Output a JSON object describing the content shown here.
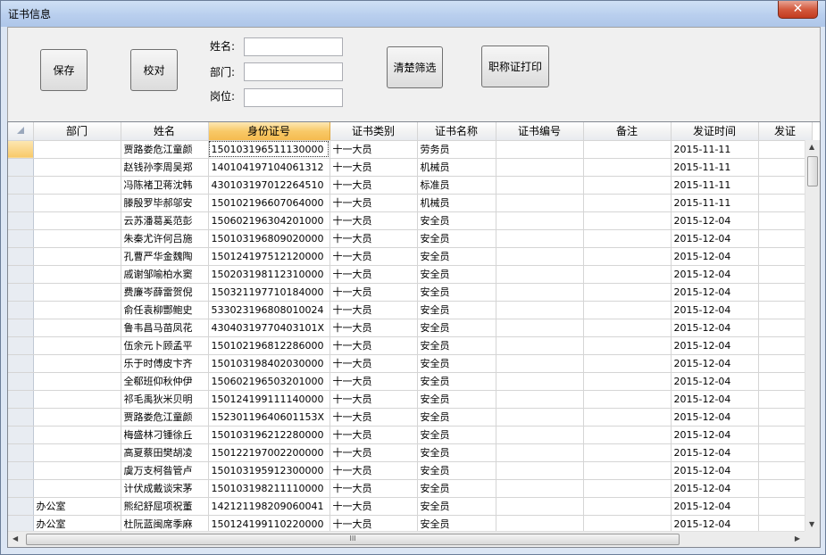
{
  "window": {
    "title": "证书信息",
    "close_glyph": "✕"
  },
  "toolbar": {
    "save_label": "保存",
    "check_label": "校对",
    "clear_filter_label": "清楚筛选",
    "print_label": "职称证打印",
    "name_label": "姓名:",
    "dept_label": "部门:",
    "post_label": "岗位:",
    "name_value": "",
    "dept_value": "",
    "post_value": ""
  },
  "grid": {
    "columns": [
      "部门",
      "姓名",
      "身份证号",
      "证书类别",
      "证书名称",
      "证书编号",
      "备注",
      "发证时间",
      "发证"
    ],
    "rows": [
      [
        "",
        "贾路娄危江童颜",
        "150103196511130000",
        "十一大员",
        "劳务员",
        "",
        "",
        "2015-11-11"
      ],
      [
        "",
        "赵钱孙李周吴郑",
        "140104197104061312",
        "十一大员",
        "机械员",
        "",
        "",
        "2015-11-11"
      ],
      [
        "",
        "冯陈褚卫蒋沈韩",
        "430103197012264510",
        "十一大员",
        "标准员",
        "",
        "",
        "2015-11-11"
      ],
      [
        "",
        "滕殷罗毕郝邬安",
        "150102196607064000",
        "十一大员",
        "机械员",
        "",
        "",
        "2015-11-11"
      ],
      [
        "",
        "云苏潘葛奚范彭",
        "150602196304201000",
        "十一大员",
        "安全员",
        "",
        "",
        "2015-12-04"
      ],
      [
        "",
        "朱秦尤许何吕施",
        "150103196809020000",
        "十一大员",
        "安全员",
        "",
        "",
        "2015-12-04"
      ],
      [
        "",
        "孔曹严华金魏陶",
        "150124197512120000",
        "十一大员",
        "安全员",
        "",
        "",
        "2015-12-04"
      ],
      [
        "",
        "戚谢邹喻柏水窦",
        "150203198112310000",
        "十一大员",
        "安全员",
        "",
        "",
        "2015-12-04"
      ],
      [
        "",
        "费廉岑薛雷贺倪",
        "150321197710184000",
        "十一大员",
        "安全员",
        "",
        "",
        "2015-12-04"
      ],
      [
        "",
        "俞任袁柳酆鲍史",
        "533023196808010024",
        "十一大员",
        "安全员",
        "",
        "",
        "2015-12-04"
      ],
      [
        "",
        "鲁韦昌马苗凤花",
        "43040319770403101X",
        "十一大员",
        "安全员",
        "",
        "",
        "2015-12-04"
      ],
      [
        "",
        "伍余元卜顾孟平",
        "150102196812286000",
        "十一大员",
        "安全员",
        "",
        "",
        "2015-12-04"
      ],
      [
        "",
        "乐于时傅皮卞齐",
        "150103198402030000",
        "十一大员",
        "安全员",
        "",
        "",
        "2015-12-04"
      ],
      [
        "",
        "全郗班仰秋仲伊",
        "150602196503201000",
        "十一大员",
        "安全员",
        "",
        "",
        "2015-12-04"
      ],
      [
        "",
        "祁毛禹狄米贝明",
        "150124199111140000",
        "十一大员",
        "安全员",
        "",
        "",
        "2015-12-04"
      ],
      [
        "",
        "贾路娄危江童颜",
        "15230119640601153X",
        "十一大员",
        "安全员",
        "",
        "",
        "2015-12-04"
      ],
      [
        "",
        "梅盛林刁锺徐丘",
        "150103196212280000",
        "十一大员",
        "安全员",
        "",
        "",
        "2015-12-04"
      ],
      [
        "",
        "高夏蔡田樊胡凌",
        "150122197002200000",
        "十一大员",
        "安全员",
        "",
        "",
        "2015-12-04"
      ],
      [
        "",
        "虞万支柯昝管卢",
        "150103195912300000",
        "十一大员",
        "安全员",
        "",
        "",
        "2015-12-04"
      ],
      [
        "",
        "计伏成戴谈宋茅",
        "150103198211110000",
        "十一大员",
        "安全员",
        "",
        "",
        "2015-12-04"
      ],
      [
        "办公室",
        "熊纪舒屈项祝董",
        "142121198209060041",
        "十一大员",
        "安全员",
        "",
        "",
        "2015-12-04"
      ],
      [
        "办公室",
        "杜阮蓝闽席季麻",
        "150124199110220000",
        "十一大员",
        "安全员",
        "",
        "",
        "2015-12-04"
      ]
    ],
    "hscroll_grip": "III"
  }
}
